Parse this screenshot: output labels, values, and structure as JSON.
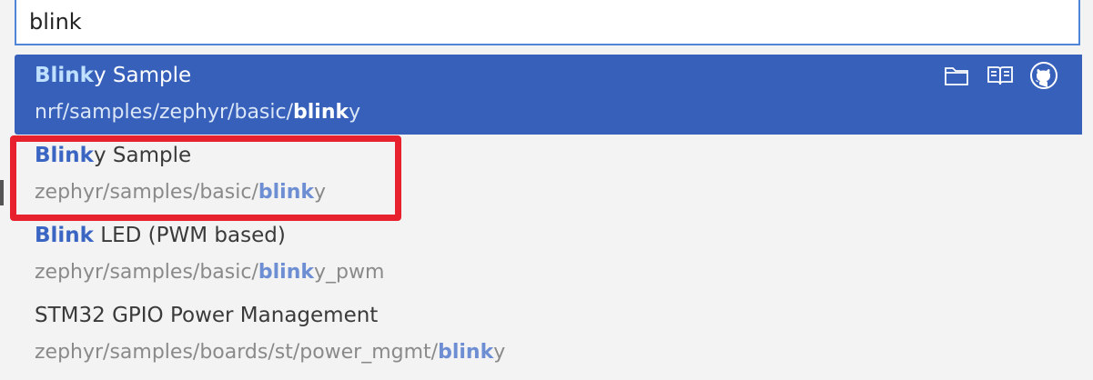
{
  "search": {
    "value": "blink"
  },
  "results": [
    {
      "title_hl": "Blink",
      "title_rest": "y Sample",
      "path_pre": "nrf/samples/zephyr/basic/",
      "path_hl": "blink",
      "path_post": "y",
      "selected": true
    },
    {
      "title_hl": "Blink",
      "title_rest": "y Sample",
      "path_pre": "zephyr/samples/basic/",
      "path_hl": "blink",
      "path_post": "y"
    },
    {
      "title_hl": "Blink",
      "title_rest": " LED (PWM based)",
      "path_pre": "zephyr/samples/basic/",
      "path_hl": "blink",
      "path_post": "y_pwm"
    },
    {
      "title_hl": "",
      "title_rest": "STM32 GPIO Power Management",
      "path_pre": "zephyr/samples/boards/st/power_mgmt/",
      "path_hl": "blink",
      "path_post": "y"
    }
  ],
  "actions": [
    {
      "icon": "folder-icon"
    },
    {
      "icon": "book-icon"
    },
    {
      "icon": "github-icon"
    }
  ],
  "annotation": {
    "color": "#e8212e"
  }
}
